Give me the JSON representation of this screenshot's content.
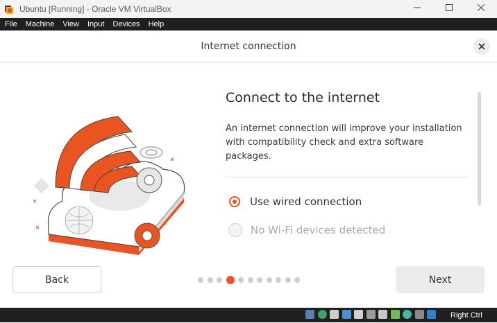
{
  "window": {
    "title": "Ubuntu [Running] - Oracle VM VirtualBox",
    "controls": [
      "minimize-icon",
      "maximize-icon",
      "close-icon"
    ]
  },
  "menubar": {
    "items": [
      "File",
      "Machine",
      "View",
      "Input",
      "Devices",
      "Help"
    ]
  },
  "installer": {
    "header_title": "Internet connection",
    "heading": "Connect to the internet",
    "description": "An internet connection will improve your installation with compatibility check and extra software packages.",
    "options": [
      {
        "label": "Use wired connection",
        "selected": true,
        "enabled": true
      },
      {
        "label": "No Wi-Fi devices detected",
        "selected": false,
        "enabled": false
      }
    ],
    "back_label": "Back",
    "next_label": "Next",
    "progress": {
      "total_steps": 11,
      "current_step": 4
    }
  },
  "statusbar": {
    "host_key": "Right Ctrl",
    "icons": [
      "hard-disk-icon",
      "optical-drive-icon",
      "audio-icon",
      "network-icon",
      "usb-icon",
      "shared-folder-icon",
      "display-icon",
      "video-capture-icon",
      "mouse-integration-icon",
      "cpu-icon",
      "arrow-down-icon"
    ]
  },
  "colors": {
    "accent": "#e95420",
    "menubar_bg": "#1f1f1f",
    "statusbar_bg": "#202020"
  }
}
